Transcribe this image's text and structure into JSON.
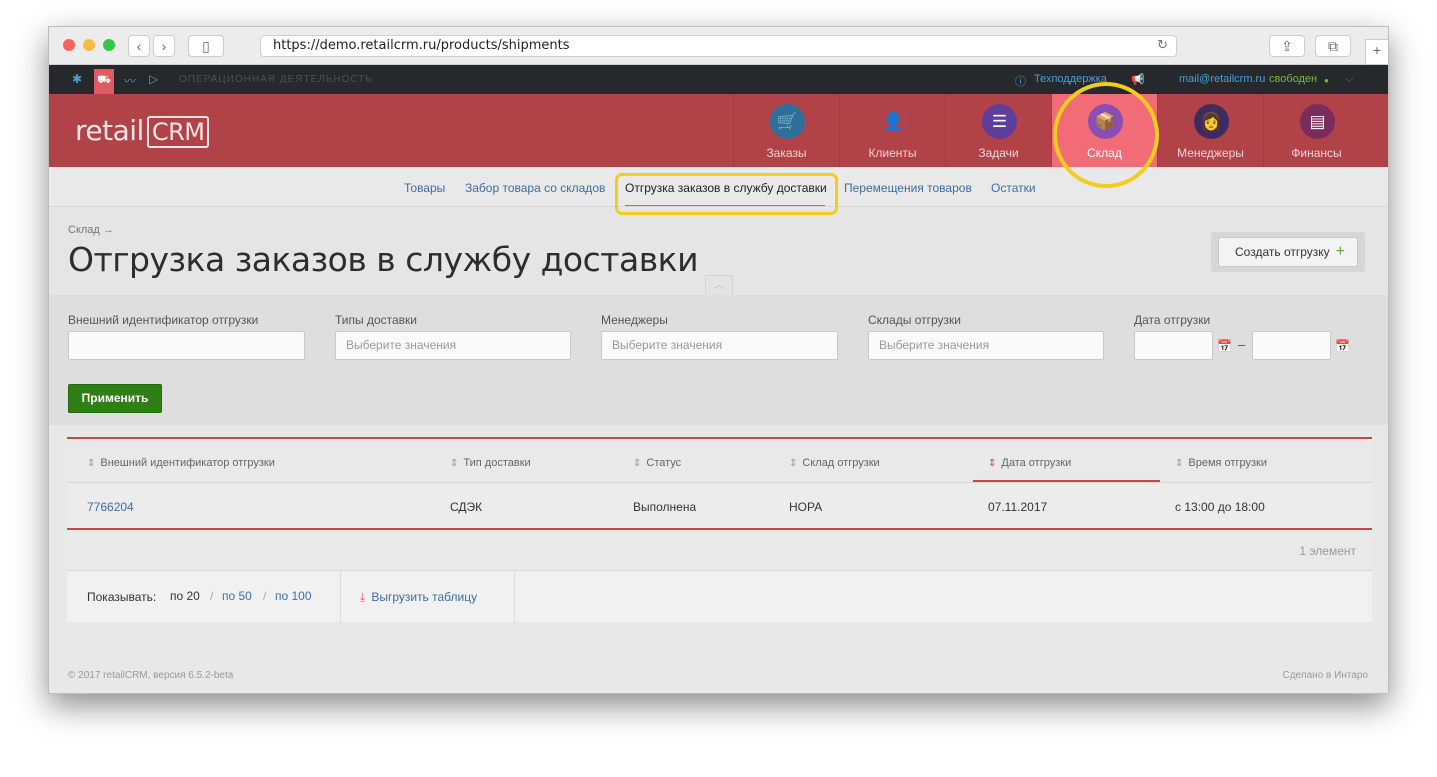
{
  "browser": {
    "url": "https://demo.retailcrm.ru/products/shipments"
  },
  "topbar": {
    "section_label": "ОПЕРАЦИОННАЯ ДЕЯТЕЛЬНОСТЬ",
    "support": "Техподдержка",
    "email": "mail@retailcrm.ru",
    "status": "свободен"
  },
  "header": {
    "logo": "retail",
    "logo_crm": "CRM",
    "modules": [
      {
        "label": "Заказы",
        "icon": "cart-icon",
        "color": "#2d6f9b"
      },
      {
        "label": "Клиенты",
        "icon": "person-icon",
        "color": "#b0434c"
      },
      {
        "label": "Задачи",
        "icon": "chat-list-icon",
        "color": "#5f3d9a"
      },
      {
        "label": "Склад",
        "icon": "box-icon",
        "color": "#8a4db3"
      },
      {
        "label": "Менеджеры",
        "icon": "woman-icon",
        "color": "#3e2c5e"
      },
      {
        "label": "Финансы",
        "icon": "ledger-icon",
        "color": "#7a2d5c"
      }
    ]
  },
  "subnav": {
    "items": [
      "Товары",
      "Забор товара со складов",
      "Отгрузка заказов в службу доставки",
      "Перемещения товаров",
      "Остатки"
    ]
  },
  "page": {
    "breadcrumb": "Склад →",
    "title": "Отгрузка заказов в службу доставки",
    "create_button": "Создать отгрузку"
  },
  "filters": {
    "external_id_label": "Внешний идентификатор отгрузки",
    "external_id_value": "",
    "delivery_types_label": "Типы доставки",
    "delivery_types_placeholder": "Выберите значения",
    "managers_label": "Менеджеры",
    "managers_placeholder": "Выберите значения",
    "stores_label": "Склады отгрузки",
    "stores_placeholder": "Выберите значения",
    "date_label": "Дата отгрузки",
    "date_separator": "–",
    "apply_button": "Применить"
  },
  "table": {
    "columns": [
      "Внешний идентификатор отгрузки",
      "Тип доставки",
      "Статус",
      "Склад отгрузки",
      "Дата отгрузки",
      "Время отгрузки"
    ],
    "rows": [
      [
        "7766204",
        "СДЭК",
        "Выполнена",
        "НОРА",
        "07.11.2017",
        "с 13:00 до 18:00"
      ]
    ],
    "count": "1 элемент",
    "show_label": "Показывать:",
    "page_sizes": [
      "по 20",
      "по 50",
      "по 100"
    ],
    "export": "Выгрузить таблицу"
  },
  "footer": {
    "copyright": "© 2017 retailCRM, версия 6.5.2-beta",
    "made_by": "Сделано в Интаро"
  }
}
